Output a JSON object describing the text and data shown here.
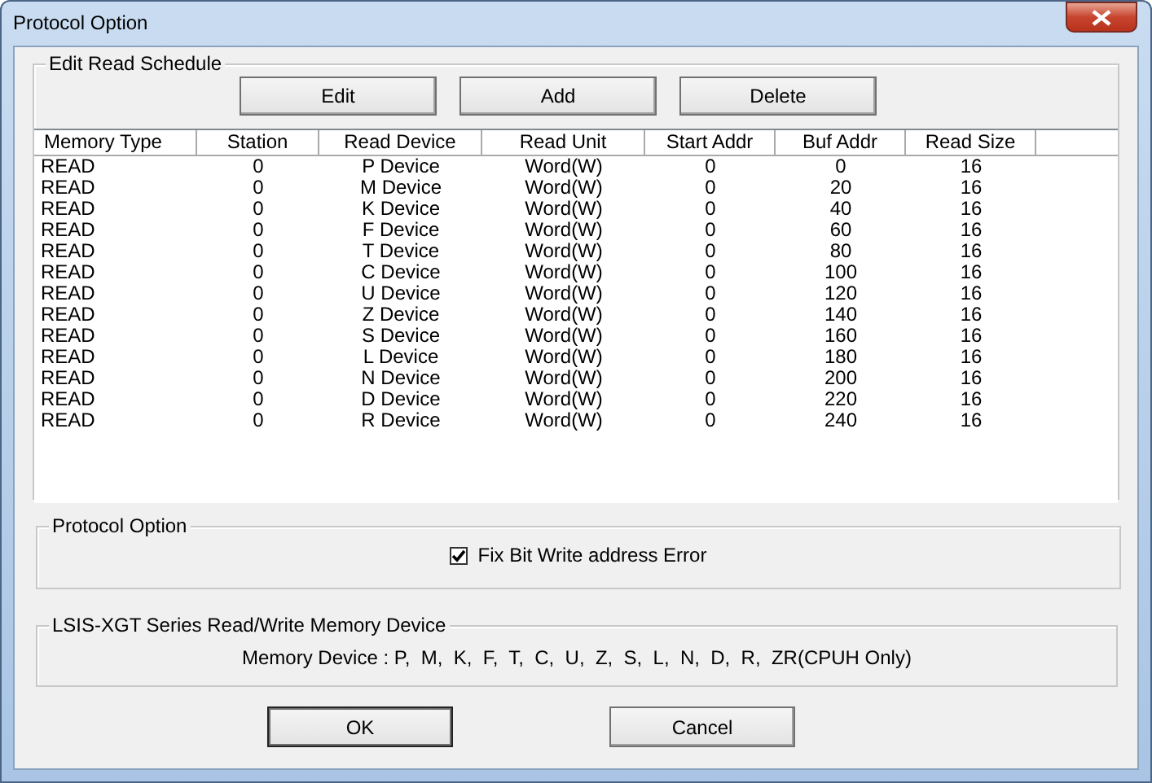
{
  "window": {
    "title": "Protocol Option"
  },
  "schedule": {
    "title": "Edit Read Schedule",
    "buttons": [
      "Edit",
      "Add",
      "Delete"
    ],
    "columns": [
      "Memory Type",
      "Station",
      "Read Device",
      "Read Unit",
      "Start Addr",
      "Buf Addr",
      "Read Size"
    ],
    "rows": [
      [
        "READ",
        "0",
        "P Device",
        "Word(W)",
        "0",
        "0",
        "16"
      ],
      [
        "READ",
        "0",
        "M Device",
        "Word(W)",
        "0",
        "20",
        "16"
      ],
      [
        "READ",
        "0",
        "K Device",
        "Word(W)",
        "0",
        "40",
        "16"
      ],
      [
        "READ",
        "0",
        "F Device",
        "Word(W)",
        "0",
        "60",
        "16"
      ],
      [
        "READ",
        "0",
        "T Device",
        "Word(W)",
        "0",
        "80",
        "16"
      ],
      [
        "READ",
        "0",
        "C Device",
        "Word(W)",
        "0",
        "100",
        "16"
      ],
      [
        "READ",
        "0",
        "U Device",
        "Word(W)",
        "0",
        "120",
        "16"
      ],
      [
        "READ",
        "0",
        "Z Device",
        "Word(W)",
        "0",
        "140",
        "16"
      ],
      [
        "READ",
        "0",
        "S Device",
        "Word(W)",
        "0",
        "160",
        "16"
      ],
      [
        "READ",
        "0",
        "L Device",
        "Word(W)",
        "0",
        "180",
        "16"
      ],
      [
        "READ",
        "0",
        "N Device",
        "Word(W)",
        "0",
        "200",
        "16"
      ],
      [
        "READ",
        "0",
        "D Device",
        "Word(W)",
        "0",
        "220",
        "16"
      ],
      [
        "READ",
        "0",
        "R Device",
        "Word(W)",
        "0",
        "240",
        "16"
      ]
    ]
  },
  "protocol_option": {
    "title": "Protocol Option",
    "checkbox": {
      "label": "Fix Bit Write address Error",
      "checked": true
    }
  },
  "memory_device": {
    "title": "LSIS-XGT Series Read/Write Memory Device",
    "text": "Memory Device : P,  M,  K,  F,  T,  C,  U,  Z,  S,  L,  N,  D,  R,  ZR(CPUH Only)"
  },
  "buttons": [
    "OK",
    "Cancel"
  ]
}
